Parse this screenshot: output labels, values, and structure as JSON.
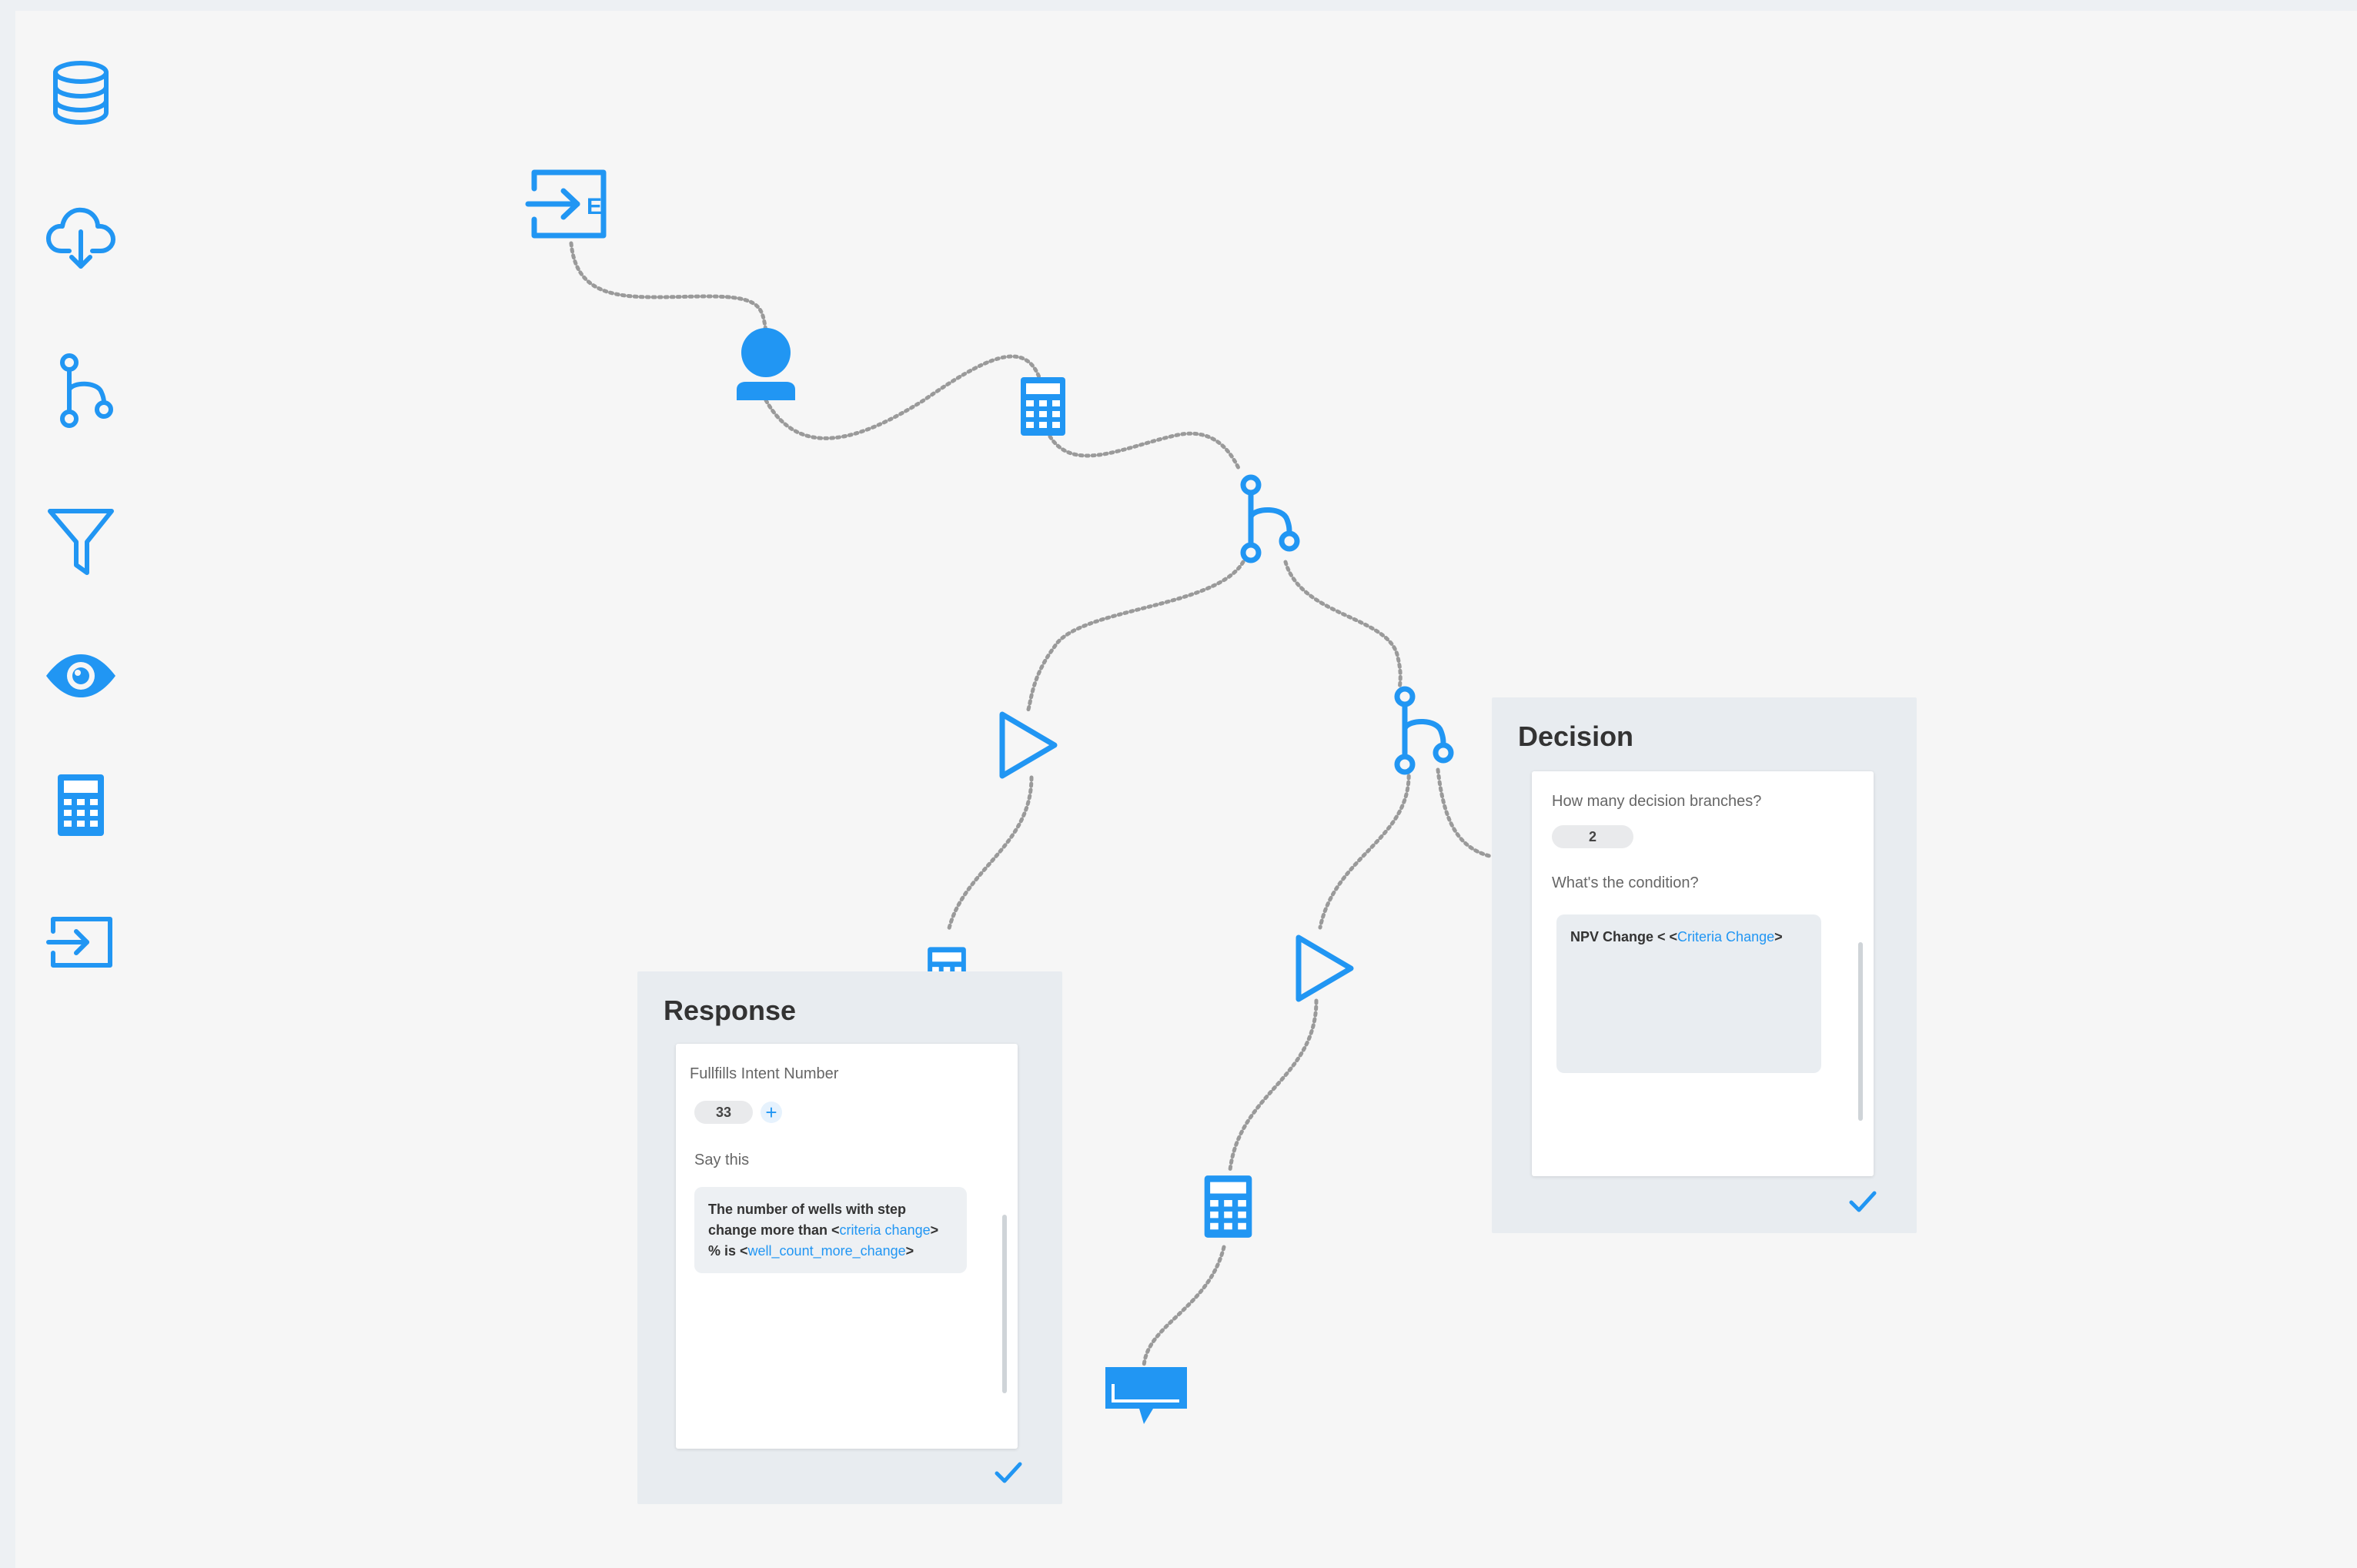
{
  "toolbar": {
    "items": [
      {
        "icon": "database-icon"
      },
      {
        "icon": "cloud-download-icon"
      },
      {
        "icon": "decision-branch-icon"
      },
      {
        "icon": "filter-icon"
      },
      {
        "icon": "eye-icon"
      },
      {
        "icon": "calculator-icon"
      },
      {
        "icon": "enter-icon"
      }
    ]
  },
  "colors": {
    "accent": "#2196f3",
    "canvas": "#f6f6f6",
    "panel": "#e8ecf0",
    "link": "#9a9a9a"
  },
  "flow_nodes": [
    {
      "icon": "entry-node-icon"
    },
    {
      "icon": "user-node-icon"
    },
    {
      "icon": "calculator-node-icon"
    },
    {
      "icon": "decision-node-icon"
    },
    {
      "icon": "play-node-icon"
    },
    {
      "icon": "decision-node-icon"
    },
    {
      "icon": "play-node-icon"
    },
    {
      "icon": "calculator-node-icon"
    },
    {
      "icon": "response-node-icon"
    }
  ],
  "response_panel": {
    "title": "Response",
    "intent_label": "Fullfills Intent Number",
    "intent_value": "33",
    "add_label": "+",
    "say_label": "Say this",
    "say_text": {
      "part1": "The number of wells with step change more than <",
      "token1": "criteria change",
      "part2": "> % is <",
      "token2": "well_count_more_change",
      "part3": ">"
    }
  },
  "decision_panel": {
    "title": "Decision",
    "branches_label": "How many decision branches?",
    "branches_value": "2",
    "condition_label": "What's the condition?",
    "condition_text": {
      "part1": "NPV Change < <",
      "token1": "Criteria Change",
      "part2": ">"
    }
  }
}
